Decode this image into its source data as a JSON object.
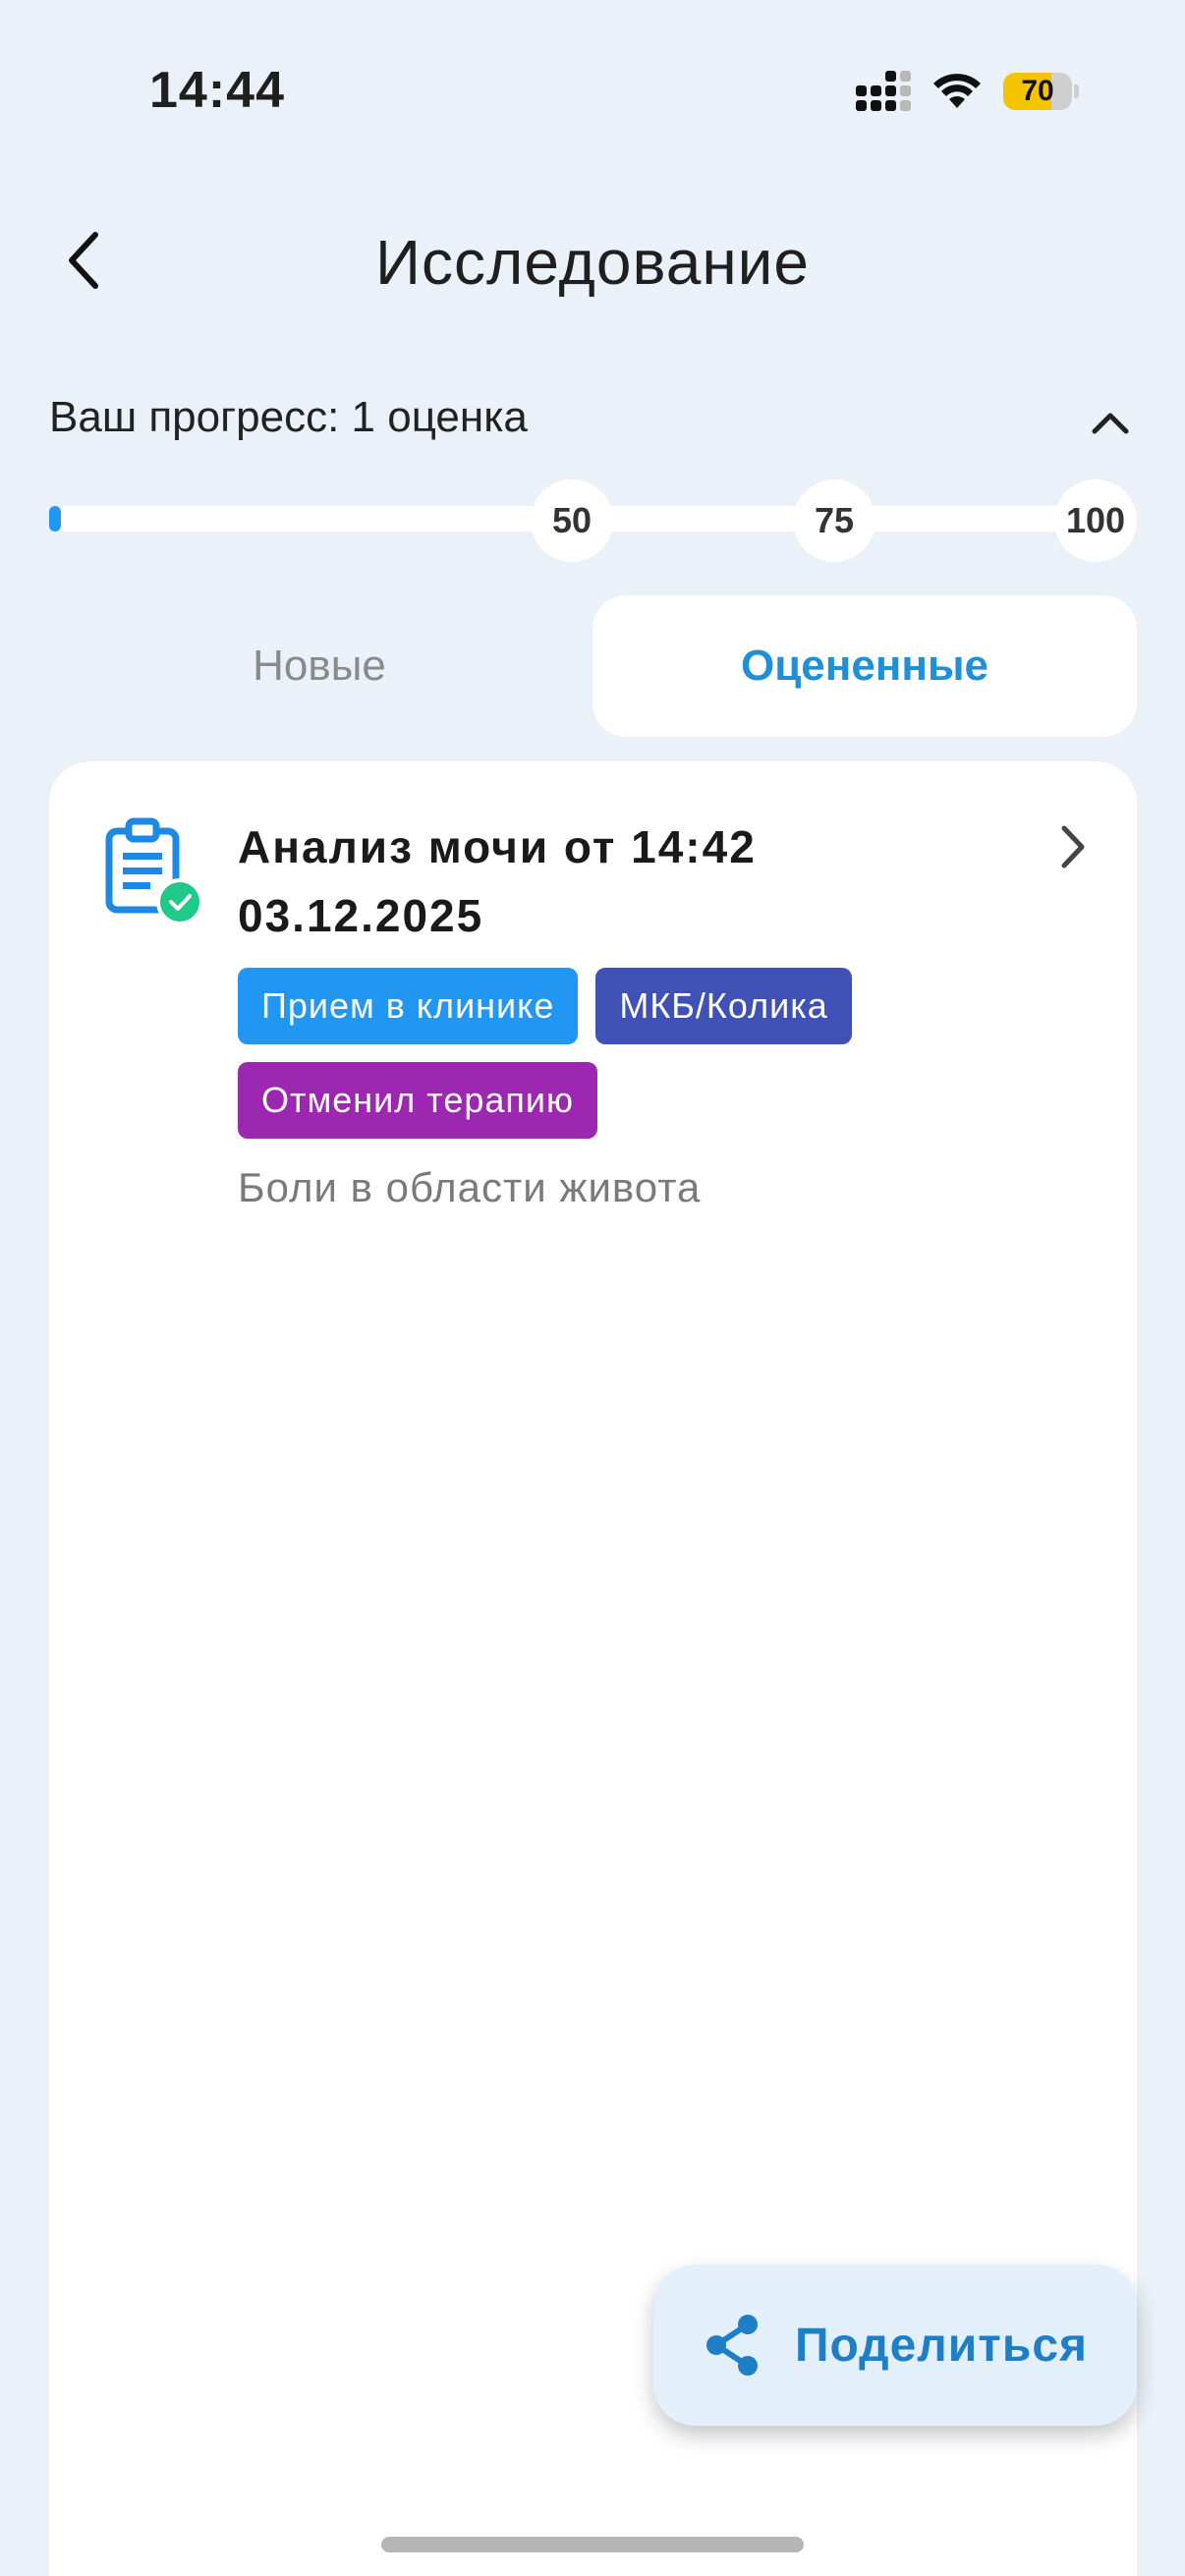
{
  "status_bar": {
    "time": "14:44",
    "battery_level": "70",
    "battery_color": "#f5c400",
    "icons": [
      "cellular-signal-icon",
      "wifi-icon",
      "battery-icon"
    ]
  },
  "header": {
    "title": "Исследование",
    "back_icon": "chevron-left-icon"
  },
  "progress": {
    "label": "Ваш прогресс: 1 оценка",
    "collapse_icon": "chevron-up-icon",
    "current_count": 1,
    "max": 100,
    "milestones": [
      "50",
      "75",
      "100"
    ],
    "accent_color": "#2196f3"
  },
  "tabs": [
    {
      "label": "Новые",
      "active": false
    },
    {
      "label": "Оцененные",
      "active": true
    }
  ],
  "items": [
    {
      "title": "Анализ мочи от 14:42 03.12.2025",
      "icon": "clipboard-check-icon",
      "tags": [
        {
          "label": "Прием в клинике",
          "color": "#2196f3"
        },
        {
          "label": "МКБ/Колика",
          "color": "#3f51b5"
        },
        {
          "label": "Отменил терапию",
          "color": "#9c27b0"
        }
      ],
      "description": "Боли в области живота"
    }
  ],
  "share": {
    "label": "Поделиться",
    "icon": "share-icon",
    "color": "#1f7fc6"
  }
}
